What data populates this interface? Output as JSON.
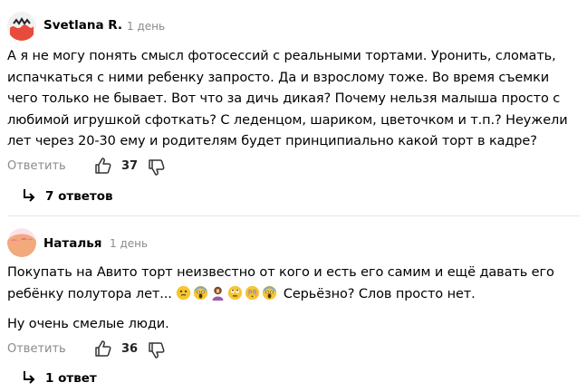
{
  "comments": [
    {
      "author": "Svetlana R.",
      "time": "1 день",
      "paragraphs": [
        "А я не могу понять смысл фотосессий с реальными тортами. Уронить, сломать, испачкаться с ними ребенку запросто. Да и взрослому тоже. Во время съемки чего только не бывает. Вот что за дичь дикая? Почему нельзя малыша просто с любимой игрушкой сфоткать? С леденцом, шариком, цветочком и т.п.? Неужели лет через 20-30 ему и родителям будет принципиально какой торт в кадре?"
      ],
      "reply_label": "Ответить",
      "likes": "37",
      "replies_label": "7 ответов"
    },
    {
      "author": "Наталья",
      "time": "1 день",
      "paragraph1_before_emoji": "Покупать на Авито торт неизвестно от кого и есть его самим и ещё давать его ребёнку полутора лет... ",
      "emojis": [
        "thinking-face",
        "screaming-face",
        "facepalm",
        "rolling-eyes-face",
        "flushed-face",
        "screaming-face"
      ],
      "paragraph1_after_emoji": " Серьёзно? Слов просто нет.",
      "paragraph2": "Ну очень смелые люди.",
      "reply_label": "Ответить",
      "likes": "36",
      "replies_label": "1 ответ"
    }
  ],
  "colors": {
    "avatar1_bg": "#f4f4f4",
    "avatar2_bg": "#fce4ec",
    "muted_text": "#8b8b8b"
  }
}
